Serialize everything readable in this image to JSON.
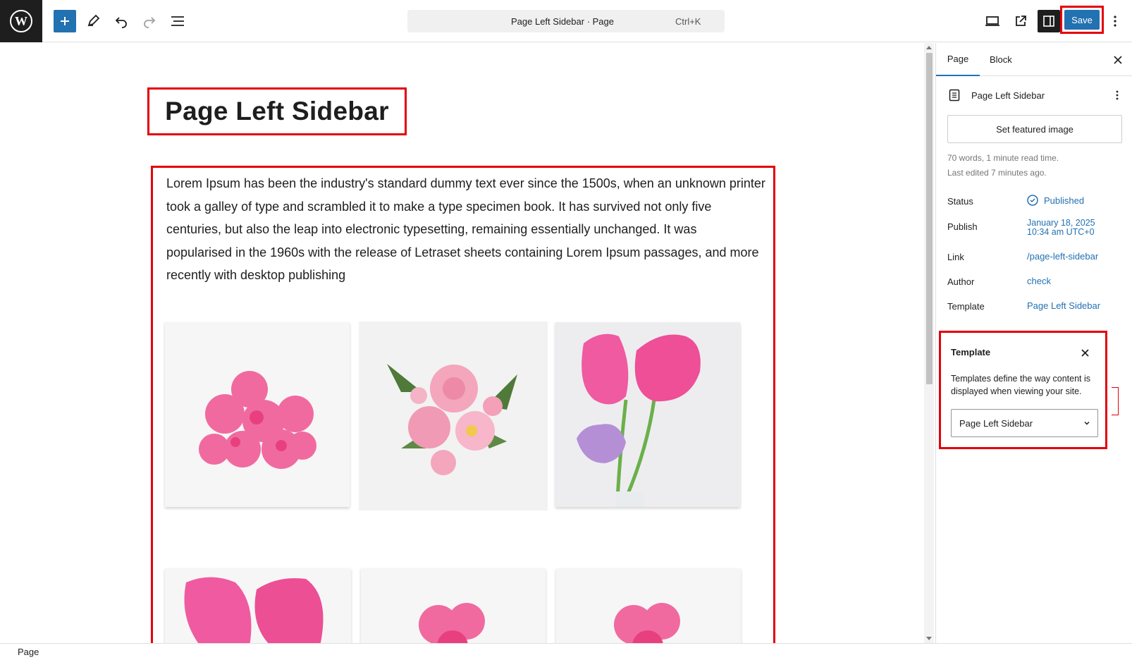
{
  "topbar": {
    "command_title": "Page Left Sidebar · Page",
    "command_shortcut": "Ctrl+K",
    "save_label": "Save"
  },
  "editor": {
    "title": "Page Left Sidebar",
    "paragraph": "Lorem Ipsum has been the industry's standard dummy text ever since the 1500s, when an unknown printer took a galley of type and scrambled it to make a type specimen book. It has survived not only five centuries, but also the leap into electronic typesetting, remaining essentially unchanged. It was popularised in the 1960s with the release of Letraset sheets containing Lorem Ipsum passages, and more recently with desktop publishing",
    "gallery": [
      "pink-geranium-photo",
      "rose-bouquet-photo",
      "pink-tulips-photo",
      "pink-tulip-closeup-photo",
      "pink-geranium-photo-2",
      "pink-geranium-photo-3"
    ]
  },
  "sidebar": {
    "tab_page": "Page",
    "tab_block": "Block",
    "doc_title": "Page Left Sidebar",
    "featured_image_button": "Set featured image",
    "meta_words": "70 words, 1 minute read time.",
    "meta_edited": "Last edited 7 minutes ago.",
    "rows": {
      "status_label": "Status",
      "status_value": "Published",
      "publish_label": "Publish",
      "publish_date": "January 18, 2025",
      "publish_time": "10:34 am UTC+0",
      "link_label": "Link",
      "link_value": "/page-left-sidebar",
      "author_label": "Author",
      "author_value": "check",
      "template_label": "Template",
      "template_value": "Page Left Sidebar"
    },
    "template_popover": {
      "title": "Template",
      "description": "Templates define the way content is displayed when viewing your site.",
      "selected": "Page Left Sidebar"
    }
  },
  "footer": {
    "breadcrumb": "Page"
  },
  "colors": {
    "accent": "#2271b1",
    "highlight": "#e3000b"
  }
}
